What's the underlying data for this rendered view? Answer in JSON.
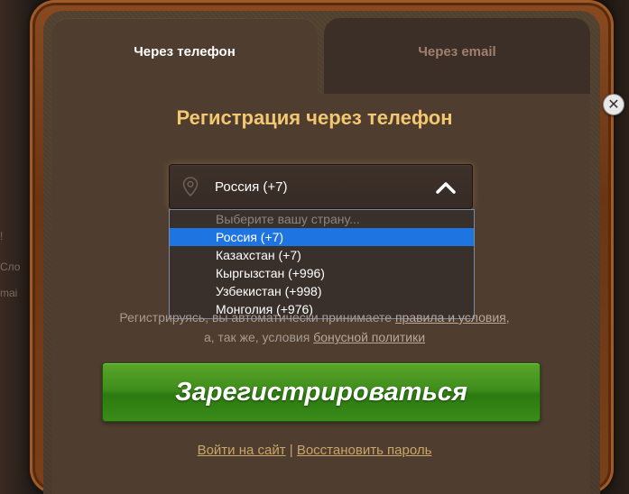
{
  "tabs": {
    "phone": "Через телефон",
    "email": "Через email"
  },
  "title": "Регистрация через телефон",
  "country_select": {
    "value": "Россия (+7)",
    "options": [
      "Выберите вашу страну...",
      "Россия (+7)",
      "Казахстан (+7)",
      "Кыргызстан (+996)",
      "Узбекистан (+998)",
      "Монголия (+976)"
    ]
  },
  "terms": {
    "prefix": "Регистрируясь, вы автоматически принимаете ",
    "rules_link": "правила и условия",
    "suffix": ",",
    "line2_prefix": "а, так же, условия ",
    "bonus_link": "бонусной политики"
  },
  "register_button": "Зарегистрироваться",
  "links": {
    "login": "Войти на сайт",
    "separator": " | ",
    "restore": "Восстановить пароль"
  },
  "close_symbol": "✕",
  "background_fragments": [
    "!",
    "Сло",
    "mai"
  ],
  "colors": {
    "title": "#f3c670",
    "selected_option": "#1e74e0",
    "button_green": "#3f8e1c",
    "link_gold": "#c9a56a"
  }
}
